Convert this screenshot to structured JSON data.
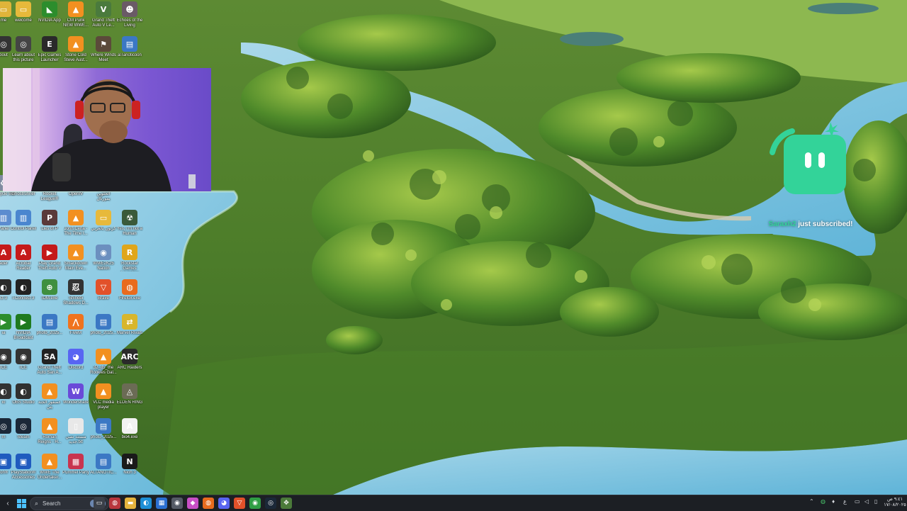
{
  "desktop": {
    "icons": [
      {
        "label": "me",
        "col": 0,
        "row": 0,
        "color": "#e0b43a",
        "glyph": "▭",
        "icon": "folder-icon"
      },
      {
        "label": "welcome",
        "col": 1,
        "row": 0,
        "color": "#e7b93b",
        "glyph": "▭",
        "icon": "folder-icon"
      },
      {
        "label": "NVIDIA App",
        "col": 2,
        "row": 0,
        "color": "#2c8d2c",
        "glyph": "◣",
        "icon": "nvidia-icon"
      },
      {
        "label": "CM Punk NEW WWE...",
        "col": 3,
        "row": 0,
        "color": "#f29020",
        "glyph": "▲",
        "icon": "vlc-icon"
      },
      {
        "label": "Grand Theft Auto V Le...",
        "col": 4,
        "row": 0,
        "color": "#4a7a3d",
        "glyph": "V",
        "icon": "gta-icon"
      },
      {
        "label": "Echoes of the Living",
        "col": 5,
        "row": 0,
        "color": "#6a5a66",
        "glyph": "☻",
        "icon": "game-icon"
      },
      {
        "label": "bout",
        "col": 0,
        "row": 1,
        "color": "#333",
        "glyph": "◎",
        "icon": "app-icon"
      },
      {
        "label": "Learn about this picture",
        "col": 1,
        "row": 1,
        "color": "#444",
        "glyph": "◎",
        "icon": "learn-icon"
      },
      {
        "label": "Epic Games Launcher",
        "col": 2,
        "row": 1,
        "color": "#2a2a2a",
        "glyph": "E",
        "icon": "epic-games-icon"
      },
      {
        "label": "Stone Cold Steve Aust...",
        "col": 3,
        "row": 1,
        "color": "#f29020",
        "glyph": "▲",
        "icon": "vlc-icon"
      },
      {
        "label": "Where Winds Meet",
        "col": 4,
        "row": 1,
        "color": "#5b4a3a",
        "glyph": "⚑",
        "icon": "game-icon"
      },
      {
        "label": "alTanoticoon",
        "col": 5,
        "row": 1,
        "color": "#3b78c4",
        "glyph": "▤",
        "icon": "image-file-icon"
      },
      {
        "label": "Recycle Bin",
        "col": 0,
        "row": 5,
        "color": "#7f8ba0",
        "glyph": "♻",
        "icon": "recycle-bin-icon"
      },
      {
        "label": "Ghostrunner",
        "col": 1,
        "row": 5,
        "color": "#7a3838",
        "glyph": "◈",
        "icon": "game-icon"
      },
      {
        "label": "Rocket League®",
        "col": 2,
        "row": 5,
        "color": "#3b6fc1",
        "glyph": "◆",
        "icon": "rocket-league-icon"
      },
      {
        "label": "OpenIV",
        "col": 3,
        "row": 5,
        "color": "#4d6b8c",
        "glyph": "▣",
        "icon": "openiv-icon"
      },
      {
        "label": "الحلوين بمورتال",
        "col": 4,
        "row": 5,
        "color": "#5c4b3c",
        "glyph": "▤",
        "icon": "image-file-icon"
      },
      {
        "label": "Panel",
        "col": 0,
        "row": 6,
        "color": "#5c8ccf",
        "glyph": "▥",
        "icon": "app-icon"
      },
      {
        "label": "Control Panel",
        "col": 1,
        "row": 6,
        "color": "#4a86cf",
        "glyph": "▥",
        "icon": "control-panel-icon"
      },
      {
        "label": "Lies of P",
        "col": 2,
        "row": 6,
        "color": "#5a3a3a",
        "glyph": "P",
        "icon": "game-icon"
      },
      {
        "label": "John Cena - The Time I...",
        "col": 3,
        "row": 6,
        "color": "#f29020",
        "glyph": "▲",
        "icon": "vlc-icon"
      },
      {
        "label": "كرتون بالعربي",
        "col": 4,
        "row": 6,
        "color": "#e7b93b",
        "glyph": "▭",
        "icon": "folder-icon"
      },
      {
        "label": "Yes, I'm not a Human",
        "col": 5,
        "row": 6,
        "color": "#3a5a3a",
        "glyph": "☢",
        "icon": "game-icon"
      },
      {
        "label": "ader",
        "col": 0,
        "row": 7,
        "color": "#c51a1a",
        "glyph": "A",
        "icon": "app-icon"
      },
      {
        "label": "Acrobat Reader",
        "col": 1,
        "row": 7,
        "color": "#c51a1a",
        "glyph": "A",
        "icon": "acrobat-icon"
      },
      {
        "label": "Play Grand Theft Auto V",
        "col": 2,
        "row": 7,
        "color": "#c41a1a",
        "glyph": "▶",
        "icon": "gta-icon"
      },
      {
        "label": "Smackdown Main Eve...",
        "col": 3,
        "row": 7,
        "color": "#f29020",
        "glyph": "▲",
        "icon": "vlc-icon"
      },
      {
        "label": "WWE2K25 Nation",
        "col": 4,
        "row": 7,
        "color": "#6c8fbf",
        "glyph": "◉",
        "icon": "game-icon"
      },
      {
        "label": "Rockstar Games Launcher",
        "col": 5,
        "row": 7,
        "color": "#e0a61b",
        "glyph": "R",
        "icon": "rockstar-icon"
      },
      {
        "label": "ct 3",
        "col": 0,
        "row": 8,
        "color": "#2a2a2a",
        "glyph": "◐",
        "icon": "app-icon"
      },
      {
        "label": "i-Connect 3",
        "col": 1,
        "row": 8,
        "color": "#222",
        "glyph": "◐",
        "icon": "iconnect-icon"
      },
      {
        "label": "IDM.exe",
        "col": 2,
        "row": 8,
        "color": "#3f8f3f",
        "glyph": "⊕",
        "icon": "idm-icon"
      },
      {
        "label": "Shinobi Shadows D...",
        "col": 3,
        "row": 8,
        "color": "#333",
        "glyph": "忍",
        "icon": "game-icon"
      },
      {
        "label": "Brave",
        "col": 4,
        "row": 8,
        "color": "#e2512a",
        "glyph": "▽",
        "icon": "brave-icon"
      },
      {
        "label": "Firefox.exe",
        "col": 5,
        "row": 8,
        "color": "#e96b1e",
        "glyph": "◍",
        "icon": "firefox-icon"
      },
      {
        "label": "ia",
        "col": 0,
        "row": 9,
        "color": "#2c8d2c",
        "glyph": "▶",
        "icon": "app-icon"
      },
      {
        "label": "NVIDIA Broadcast",
        "col": 1,
        "row": 9,
        "color": "#1f7a1f",
        "glyph": "▶",
        "icon": "nvidia-broadcast-icon"
      },
      {
        "label": "photo_2025...",
        "col": 2,
        "row": 9,
        "color": "#3b78c4",
        "glyph": "▤",
        "icon": "image-file-icon"
      },
      {
        "label": "FiveM",
        "col": 3,
        "row": 9,
        "color": "#f0731e",
        "glyph": "⋀",
        "icon": "fivem-icon"
      },
      {
        "label": "photo_2025...",
        "col": 4,
        "row": 9,
        "color": "#3b78c4",
        "glyph": "▤",
        "icon": "image-file-icon"
      },
      {
        "label": "Marvel Rivals",
        "col": 5,
        "row": 9,
        "color": "#d8b62c",
        "glyph": "⇄",
        "icon": "game-icon"
      },
      {
        "label": "ICE",
        "col": 0,
        "row": 10,
        "color": "#333",
        "glyph": "◉",
        "icon": "app-icon"
      },
      {
        "label": "ICE",
        "col": 1,
        "row": 10,
        "color": "#333",
        "glyph": "◉",
        "icon": "ice-icon"
      },
      {
        "label": "Grand Theft Auto San A...",
        "col": 2,
        "row": 10,
        "color": "#222",
        "glyph": "SA",
        "icon": "gta-sa-icon"
      },
      {
        "label": "Discord",
        "col": 3,
        "row": 10,
        "color": "#5865f2",
        "glyph": "◕",
        "icon": "discord-icon"
      },
      {
        "label": "32_85_the Rookies Gal...",
        "col": 4,
        "row": 10,
        "color": "#f29020",
        "glyph": "▲",
        "icon": "vlc-icon"
      },
      {
        "label": "ARC Raiders",
        "col": 5,
        "row": 10,
        "color": "#2a2a2a",
        "glyph": "ARC",
        "icon": "arc-raiders-icon"
      },
      {
        "label": "io",
        "col": 0,
        "row": 11,
        "color": "#333",
        "glyph": "◐",
        "icon": "app-icon"
      },
      {
        "label": "OBS Studio",
        "col": 1,
        "row": 11,
        "color": "#303030",
        "glyph": "◐",
        "icon": "obs-icon"
      },
      {
        "label": "عصفور الجنة بتي",
        "col": 2,
        "row": 11,
        "color": "#f29020",
        "glyph": "▲",
        "icon": "vlc-icon"
      },
      {
        "label": "Wondershare",
        "col": 3,
        "row": 11,
        "color": "#6a4ad8",
        "glyph": "W",
        "icon": "wondershare-icon"
      },
      {
        "label": "VLC media player",
        "col": 4,
        "row": 11,
        "color": "#f29020",
        "glyph": "▲",
        "icon": "vlc-icon"
      },
      {
        "label": "ELDEN RING",
        "col": 5,
        "row": 11,
        "color": "#6b6b55",
        "glyph": "◬",
        "icon": "elden-ring-icon"
      },
      {
        "label": "m",
        "col": 0,
        "row": 12,
        "color": "#1b2838",
        "glyph": "◎",
        "icon": "app-icon"
      },
      {
        "label": "Steam",
        "col": 1,
        "row": 12,
        "color": "#1b2838",
        "glyph": "◎",
        "icon": "steam-icon"
      },
      {
        "label": "Roman Reigns - H...",
        "col": 2,
        "row": 12,
        "color": "#f29020",
        "glyph": "▲",
        "icon": "vlc-icon"
      },
      {
        "label": "مستند نصي جديد.txt",
        "col": 3,
        "row": 12,
        "color": "#e8e8e8",
        "glyph": "▯",
        "icon": "text-file-icon"
      },
      {
        "label": "photo_2025...",
        "col": 4,
        "row": 12,
        "color": "#3b78c4",
        "glyph": "▤",
        "icon": "image-file-icon"
      },
      {
        "label": "bio4.exe",
        "col": 5,
        "row": 12,
        "color": "#f2f2f2",
        "glyph": "A",
        "icon": "bio4-icon"
      },
      {
        "label": "ion®",
        "col": 0,
        "row": 13,
        "color": "#1f5bbf",
        "glyph": "▣",
        "icon": "app-icon"
      },
      {
        "label": "PlayStation® Accessories",
        "col": 1,
        "row": 13,
        "color": "#1f5bbf",
        "glyph": "▣",
        "icon": "playstation-icon"
      },
      {
        "label": "WWE The Undertaker...",
        "col": 2,
        "row": 13,
        "color": "#f29020",
        "glyph": "▲",
        "icon": "vlc-icon"
      },
      {
        "label": "Pummel Party",
        "col": 3,
        "row": 13,
        "color": "#c8344f",
        "glyph": "▦",
        "icon": "pummel-party-icon"
      },
      {
        "label": "ALTANOTIC...",
        "col": 4,
        "row": 13,
        "color": "#3b78c4",
        "glyph": "▤",
        "icon": "image-file-icon"
      },
      {
        "label": "Nioh 3",
        "col": 5,
        "row": 13,
        "color": "#1a1a1a",
        "glyph": "N",
        "icon": "nioh-icon"
      }
    ]
  },
  "alert": {
    "username": "Saraxh2",
    "message": " just subscribed!",
    "accent": "#33d399"
  },
  "taskbar": {
    "search_label": "Search",
    "apps": [
      {
        "name": "taskview",
        "glyph": "▭",
        "color": "#3a3f48",
        "icon": "task-view-icon"
      },
      {
        "name": "settings",
        "glyph": "◍",
        "color": "#b8363d",
        "icon": "app-icon"
      },
      {
        "name": "explorer",
        "glyph": "▬",
        "color": "#e5b33d",
        "icon": "file-explorer-icon"
      },
      {
        "name": "edge",
        "glyph": "◐",
        "color": "#1d8fd6",
        "icon": "edge-icon"
      },
      {
        "name": "store",
        "glyph": "▦",
        "color": "#2b6fd1",
        "icon": "store-icon"
      },
      {
        "name": "camera",
        "glyph": "◉",
        "color": "#555b66",
        "icon": "camera-icon"
      },
      {
        "name": "app-pink",
        "glyph": "◆",
        "color": "#c94fc6",
        "icon": "app-icon"
      },
      {
        "name": "firefox",
        "glyph": "◍",
        "color": "#e96b1e",
        "icon": "firefox-icon"
      },
      {
        "name": "discord",
        "glyph": "◕",
        "color": "#5865f2",
        "icon": "discord-icon"
      },
      {
        "name": "brave",
        "glyph": "▽",
        "color": "#e2512a",
        "icon": "brave-icon"
      },
      {
        "name": "chrome",
        "glyph": "◉",
        "color": "#2f9e44",
        "icon": "chrome-icon"
      },
      {
        "name": "steam",
        "glyph": "◎",
        "color": "#1b2838",
        "icon": "steam-icon"
      },
      {
        "name": "misc",
        "glyph": "✥",
        "color": "#4b7a3a",
        "icon": "app-icon"
      }
    ],
    "clock": {
      "time": "٩:٤١ ص",
      "date": "١٧/٠٨/٢٠٢٥"
    },
    "language": "ع",
    "tray_icons": [
      "chevron-up-icon",
      "shield-icon",
      "mic-icon",
      "speaker-icon",
      "network-icon",
      "volume-icon",
      "battery-icon"
    ]
  }
}
